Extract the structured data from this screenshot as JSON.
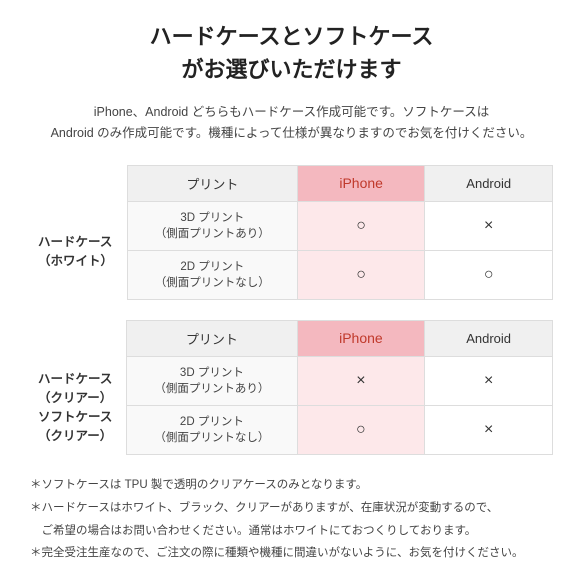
{
  "title": {
    "line1": "ハードケースとソフトケース",
    "line2": "がお選びいただけます"
  },
  "description": "iPhone、Android どちらもハードケース作成可能です。ソフトケースは\nAndroid のみ作成可能です。機種によって仕様が異なりますのでお気を付けください。",
  "table1": {
    "row_label_line1": "ハードケース",
    "row_label_line2": "（ホワイト）",
    "col_print": "プリント",
    "col_iphone": "iPhone",
    "col_android": "Android",
    "rows": [
      {
        "label_line1": "3D プリント",
        "label_line2": "（側面プリントあり）",
        "iphone": "○",
        "android": "×"
      },
      {
        "label_line1": "2D プリント",
        "label_line2": "（側面プリントなし）",
        "iphone": "○",
        "android": "○"
      }
    ]
  },
  "table2": {
    "row_label_line1a": "ハードケース",
    "row_label_line2a": "（クリアー）",
    "row_label_line1b": "ソフトケース",
    "row_label_line2b": "（クリアー）",
    "col_print": "プリント",
    "col_iphone": "iPhone",
    "col_android": "Android",
    "rows": [
      {
        "label_line1": "3D プリント",
        "label_line2": "（側面プリントあり）",
        "iphone": "×",
        "android": "×"
      },
      {
        "label_line1": "2D プリント",
        "label_line2": "（側面プリントなし）",
        "iphone": "○",
        "android": "×"
      }
    ]
  },
  "notes": [
    "＊ソフトケースは TPU 製で透明のクリアケースのみとなります。",
    "＊ハードケースはホワイト、ブラック、クリアーがありますが、在庫状況が変動するので、",
    "　ご希望の場合はお問い合わせください。通常はホワイトにておつくりしております。",
    "＊完全受注生産なので、ご注文の際に種類や機種に間違いがないように、お気を付けください。"
  ]
}
